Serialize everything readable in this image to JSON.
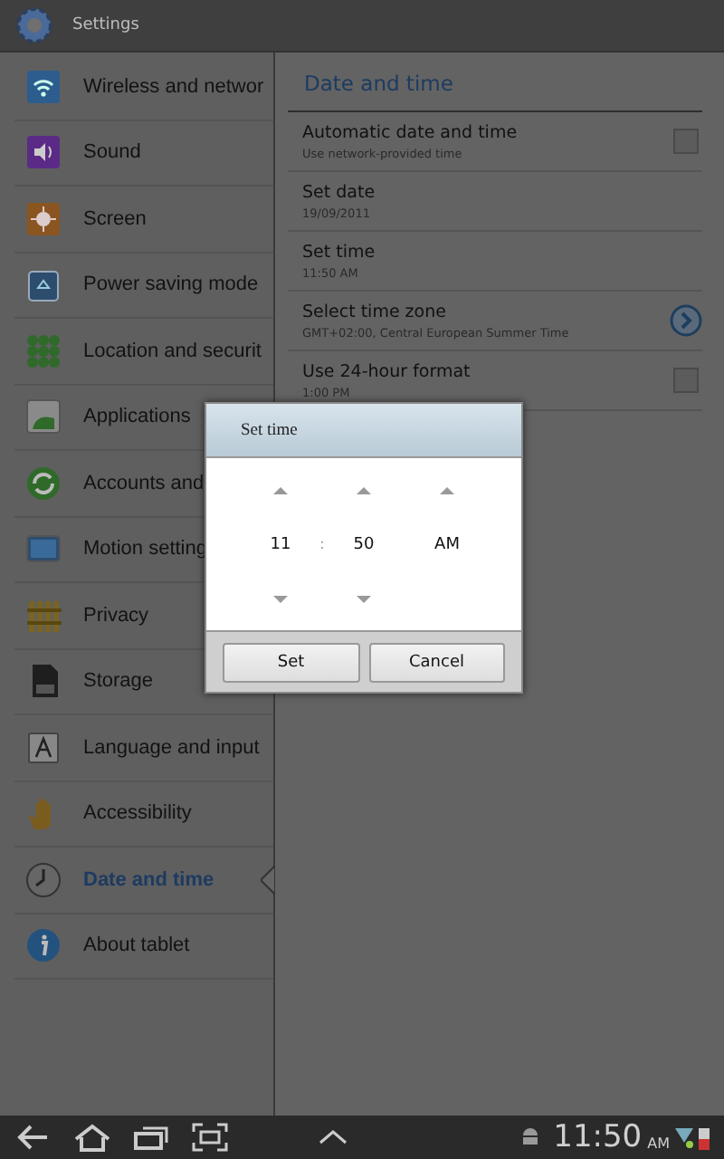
{
  "app_bar": {
    "title": "Settings"
  },
  "sidebar": {
    "items": [
      {
        "label": "Wireless and networ",
        "selected": false
      },
      {
        "label": "Sound",
        "selected": false
      },
      {
        "label": "Screen",
        "selected": false
      },
      {
        "label": "Power saving mode",
        "selected": false
      },
      {
        "label": "Location and securit",
        "selected": false
      },
      {
        "label": "Applications",
        "selected": false
      },
      {
        "label": "Accounts and",
        "selected": false
      },
      {
        "label": "Motion setting",
        "selected": false
      },
      {
        "label": "Privacy",
        "selected": false
      },
      {
        "label": "Storage",
        "selected": false
      },
      {
        "label": "Language and input",
        "selected": false
      },
      {
        "label": "Accessibility",
        "selected": false
      },
      {
        "label": "Date and time",
        "selected": true
      },
      {
        "label": "About tablet",
        "selected": false
      }
    ]
  },
  "panel": {
    "title": "Date and time",
    "items": [
      {
        "kind": "checkbox",
        "title": "Automatic date and time",
        "summary": "Use network-provided time",
        "checked": false
      },
      {
        "kind": "plain",
        "title": "Set date",
        "summary": "19/09/2011"
      },
      {
        "kind": "plain",
        "title": "Set time",
        "summary": "11:50 AM"
      },
      {
        "kind": "arrow",
        "title": "Select time zone",
        "summary": "GMT+02:00, Central European Summer Time"
      },
      {
        "kind": "checkbox",
        "title": "Use 24-hour format",
        "summary": "1:00 PM",
        "checked": false
      }
    ]
  },
  "dialog": {
    "title": "Set time",
    "separator": ":",
    "columns": [
      {
        "value": "11",
        "down": true
      },
      {
        "value": "50",
        "down": true
      },
      {
        "value": "AM",
        "down": false
      }
    ],
    "buttons": [
      "Set",
      "Cancel"
    ]
  },
  "system_bar": {
    "time": "11:50",
    "meridiem": "AM"
  }
}
